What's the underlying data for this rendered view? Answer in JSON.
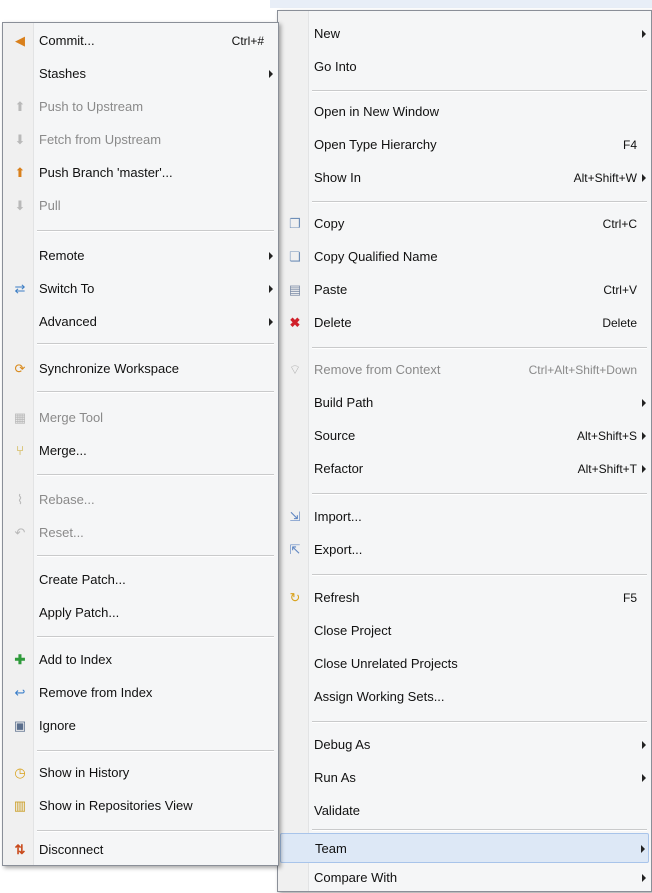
{
  "team_menu": {
    "items": [
      {
        "label": "Commit...",
        "shortcut": "Ctrl+#",
        "icon": "commit-icon",
        "enabled": true
      },
      {
        "label": "Stashes",
        "submenu": true,
        "enabled": true
      },
      {
        "label": "Push to Upstream",
        "icon": "push-upstream-icon",
        "enabled": false
      },
      {
        "label": "Fetch from Upstream",
        "icon": "fetch-upstream-icon",
        "enabled": false
      },
      {
        "label": "Push Branch 'master'...",
        "icon": "push-branch-icon",
        "enabled": true
      },
      {
        "label": "Pull",
        "icon": "pull-icon",
        "enabled": false
      },
      {
        "label": "Remote",
        "submenu": true,
        "enabled": true
      },
      {
        "label": "Switch To",
        "icon": "switch-icon",
        "submenu": true,
        "enabled": true
      },
      {
        "label": "Advanced",
        "submenu": true,
        "enabled": true
      },
      {
        "label": "Synchronize Workspace",
        "icon": "synchronize-icon",
        "enabled": true
      },
      {
        "label": "Merge Tool",
        "icon": "merge-tool-icon",
        "enabled": false
      },
      {
        "label": "Merge...",
        "icon": "merge-icon",
        "enabled": true
      },
      {
        "label": "Rebase...",
        "icon": "rebase-icon",
        "enabled": false
      },
      {
        "label": "Reset...",
        "icon": "reset-icon",
        "enabled": false
      },
      {
        "label": "Create Patch...",
        "enabled": true
      },
      {
        "label": "Apply Patch...",
        "enabled": true
      },
      {
        "label": "Add to Index",
        "icon": "add-to-index-icon",
        "enabled": true
      },
      {
        "label": "Remove from Index",
        "icon": "remove-from-index-icon",
        "enabled": true
      },
      {
        "label": "Ignore",
        "icon": "ignore-icon",
        "enabled": true
      },
      {
        "label": "Show in History",
        "icon": "history-icon",
        "enabled": true
      },
      {
        "label": "Show in Repositories View",
        "icon": "repositories-icon",
        "enabled": true
      },
      {
        "label": "Disconnect",
        "icon": "disconnect-icon",
        "enabled": true
      }
    ]
  },
  "main_menu": {
    "items": [
      {
        "label": "New",
        "submenu": true
      },
      {
        "label": "Go Into"
      },
      {
        "label": "Open in New Window"
      },
      {
        "label": "Open Type Hierarchy",
        "shortcut": "F4"
      },
      {
        "label": "Show In",
        "shortcut": "Alt+Shift+W",
        "submenu": true
      },
      {
        "label": "Copy",
        "shortcut": "Ctrl+C",
        "icon": "copy-icon"
      },
      {
        "label": "Copy Qualified Name",
        "icon": "copy-qualified-icon"
      },
      {
        "label": "Paste",
        "shortcut": "Ctrl+V",
        "icon": "paste-icon"
      },
      {
        "label": "Delete",
        "shortcut": "Delete",
        "icon": "delete-icon"
      },
      {
        "label": "Remove from Context",
        "shortcut": "Ctrl+Alt+Shift+Down",
        "icon": "remove-context-icon",
        "enabled": false
      },
      {
        "label": "Build Path",
        "submenu": true
      },
      {
        "label": "Source",
        "shortcut": "Alt+Shift+S",
        "submenu": true
      },
      {
        "label": "Refactor",
        "shortcut": "Alt+Shift+T",
        "submenu": true
      },
      {
        "label": "Import...",
        "icon": "import-icon"
      },
      {
        "label": "Export...",
        "icon": "export-icon"
      },
      {
        "label": "Refresh",
        "shortcut": "F5",
        "icon": "refresh-icon"
      },
      {
        "label": "Close Project"
      },
      {
        "label": "Close Unrelated Projects"
      },
      {
        "label": "Assign Working Sets..."
      },
      {
        "label": "Debug As",
        "submenu": true
      },
      {
        "label": "Run As",
        "submenu": true
      },
      {
        "label": "Validate"
      },
      {
        "label": "Team",
        "submenu": true,
        "highlighted": true
      },
      {
        "label": "Compare With",
        "submenu": true
      }
    ]
  },
  "colors": {
    "highlight": "#dde8f6",
    "disabled_text": "#8a8a8a",
    "menu_bg": "#f5f6f7"
  }
}
